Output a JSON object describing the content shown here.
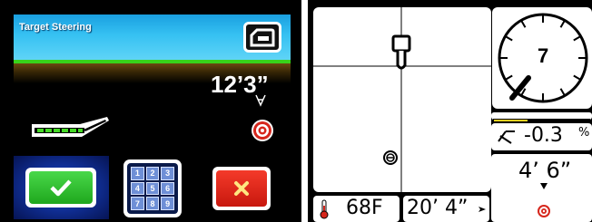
{
  "target_steering": {
    "title": "Target Steering",
    "distance": "12’3”",
    "icons": {
      "mode": "locator-icon",
      "tool": "drill-head-icon",
      "target": "target-icon",
      "arrow": "down-arrow-icon"
    },
    "buttons": {
      "ok": "check-icon",
      "keypad": [
        "1",
        "2",
        "3",
        "4",
        "5",
        "6",
        "7",
        "8",
        "9"
      ],
      "cancel": "close-icon"
    },
    "colors": {
      "header": "#36c1f2",
      "ground_line": "#37d31b",
      "ok": "#2bbf2a",
      "cancel": "#e02416",
      "target": "#d6261c"
    }
  },
  "locator_display": {
    "roll_clock": "7",
    "pitch": "-0.3",
    "pitch_unit": "%",
    "depth": "4’ 6”",
    "temperature": "68F",
    "range": "20’ 4”",
    "icons": {
      "roll": "roll-clock-icon",
      "pitch": "pitch-icon",
      "temp": "thermometer-icon",
      "target": "target-icon",
      "locator": "locator-icon",
      "ball": "ball-icon"
    },
    "signal_level": 0.35
  }
}
